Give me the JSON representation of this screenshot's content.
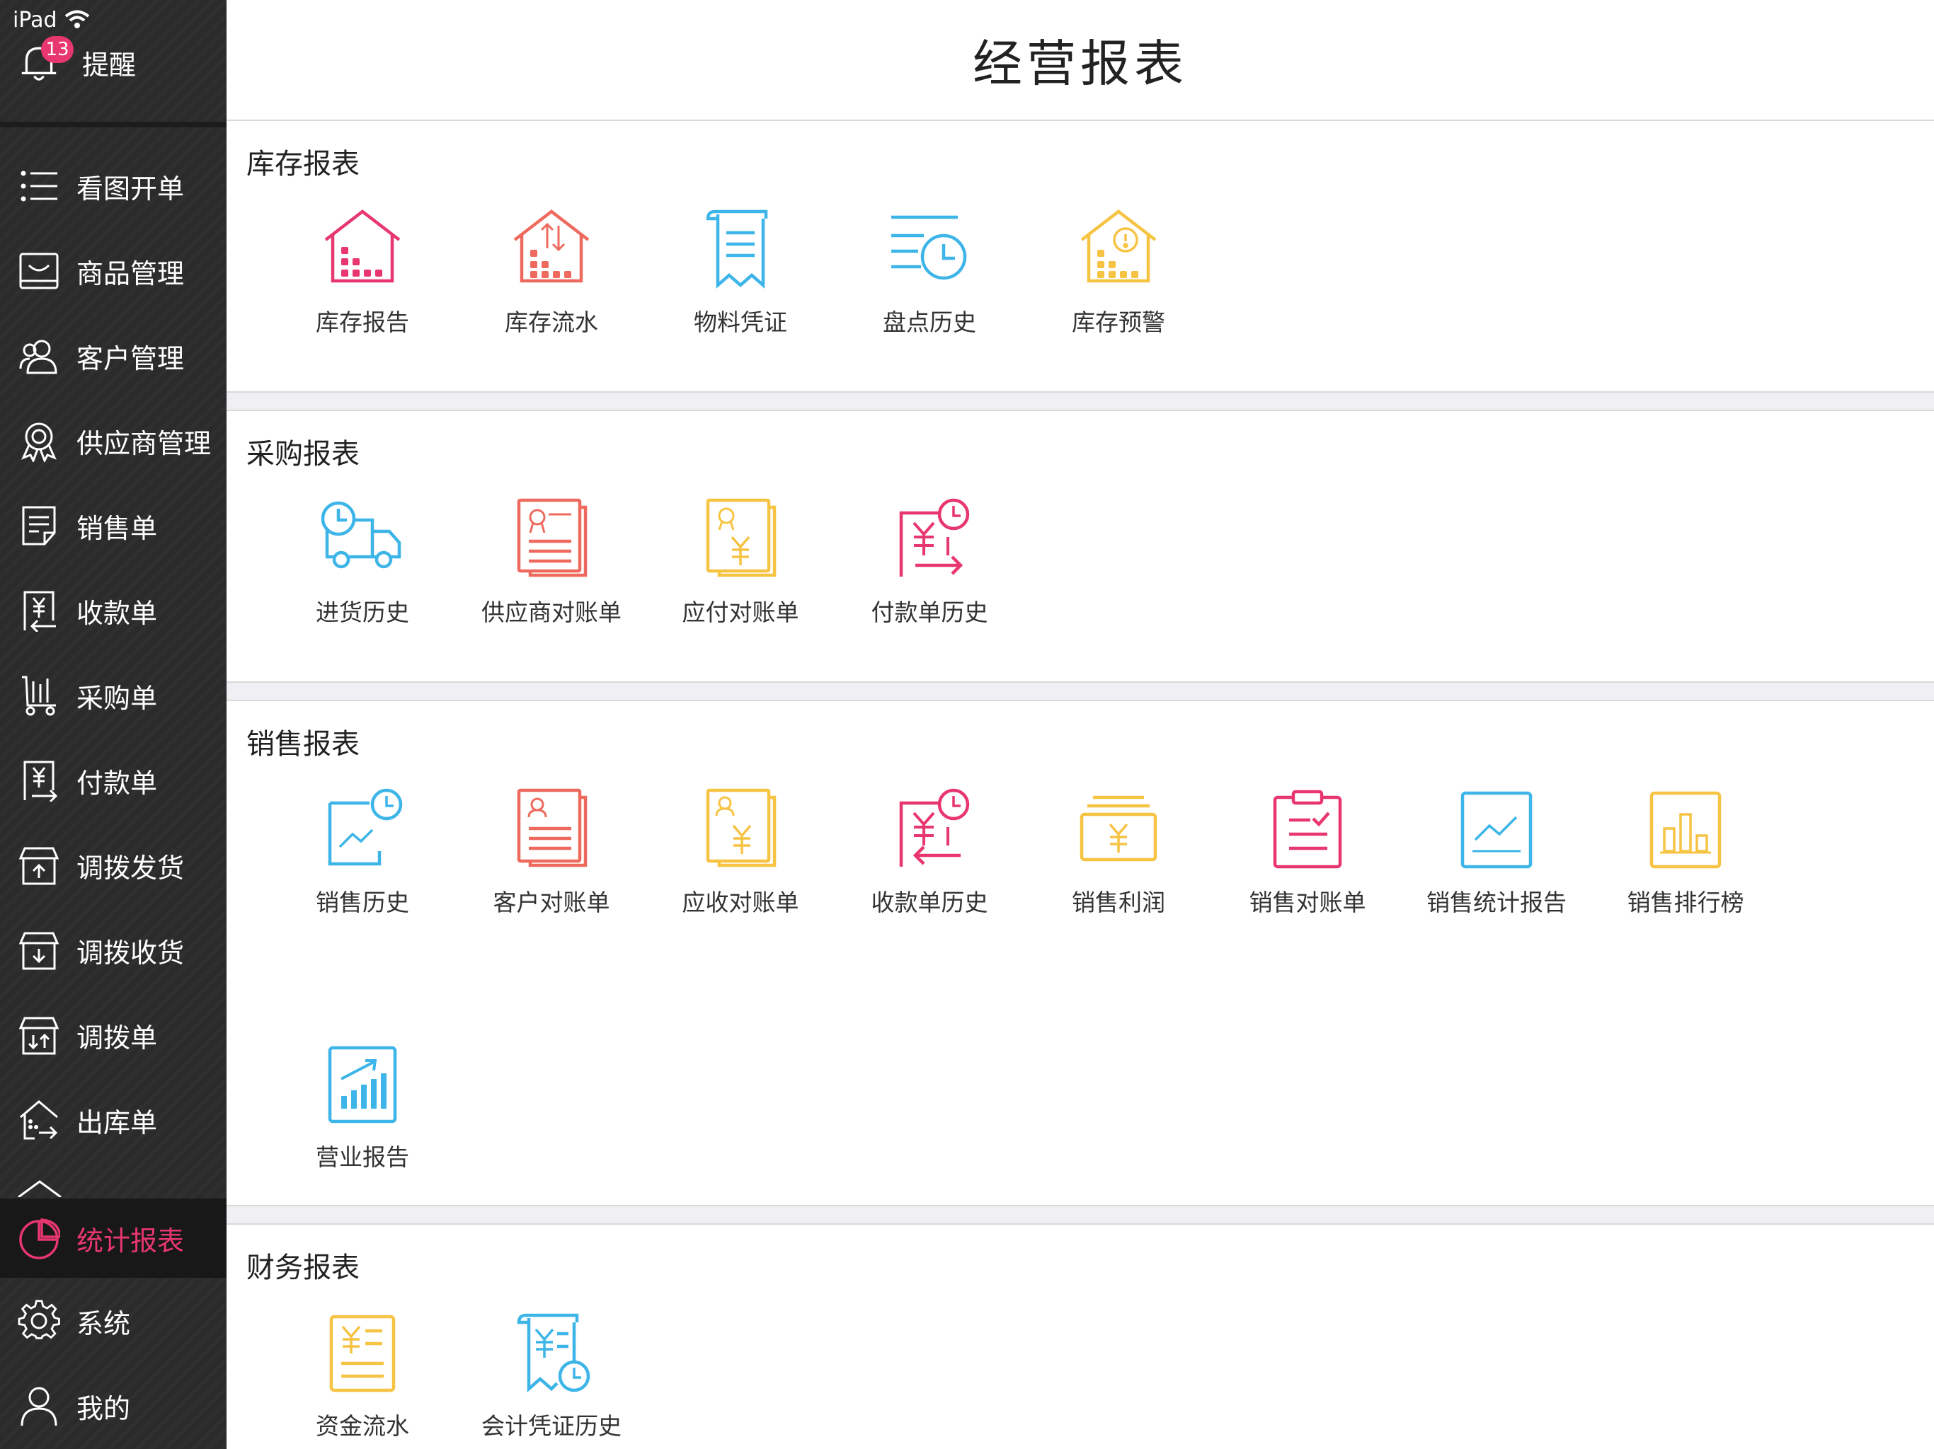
{
  "status_bar": {
    "device": "iPad"
  },
  "reminder": {
    "label": "提醒",
    "badge": "13"
  },
  "nav": [
    {
      "label": "看图开单",
      "icon": "list-icon"
    },
    {
      "label": "商品管理",
      "icon": "product-box-icon"
    },
    {
      "label": "客户管理",
      "icon": "customers-icon"
    },
    {
      "label": "供应商管理",
      "icon": "supplier-badge-icon"
    },
    {
      "label": "销售单",
      "icon": "sales-doc-icon"
    },
    {
      "label": "收款单",
      "icon": "receipt-yen-icon"
    },
    {
      "label": "采购单",
      "icon": "cart-icon"
    },
    {
      "label": "付款单",
      "icon": "payment-yen-icon"
    },
    {
      "label": "调拨发货",
      "icon": "transfer-send-icon"
    },
    {
      "label": "调拨收货",
      "icon": "transfer-receive-icon"
    },
    {
      "label": "调拨单",
      "icon": "transfer-doc-icon"
    },
    {
      "label": "出库单",
      "icon": "outbound-house-icon"
    },
    {
      "label": "统计报表",
      "icon": "pie-chart-icon"
    },
    {
      "label": "系统",
      "icon": "gear-icon"
    },
    {
      "label": "我的",
      "icon": "user-icon"
    }
  ],
  "page_title": "经营报表",
  "sections": [
    {
      "title": "库存报表",
      "items": [
        {
          "label": "库存报告",
          "icon": "house-dots-icon",
          "color": "#e8376f"
        },
        {
          "label": "库存流水",
          "icon": "house-flow-icon",
          "color": "#ee6a5e"
        },
        {
          "label": "物料凭证",
          "icon": "voucher-scroll-icon",
          "color": "#3db5e8"
        },
        {
          "label": "盘点历史",
          "icon": "inventory-clock-icon",
          "color": "#3db5e8"
        },
        {
          "label": "库存预警",
          "icon": "house-warning-icon",
          "color": "#f6c343"
        }
      ]
    },
    {
      "title": "采购报表",
      "items": [
        {
          "label": "进货历史",
          "icon": "truck-clock-icon",
          "color": "#3db5e8"
        },
        {
          "label": "供应商对账单",
          "icon": "supplier-statement-icon",
          "color": "#ee6a5e"
        },
        {
          "label": "应付对账单",
          "icon": "payable-statement-icon",
          "color": "#f6c343"
        },
        {
          "label": "付款单历史",
          "icon": "payment-history-icon",
          "color": "#e8376f"
        }
      ]
    },
    {
      "title": "销售报表",
      "items": [
        {
          "label": "销售历史",
          "icon": "sales-history-icon",
          "color": "#3db5e8"
        },
        {
          "label": "客户对账单",
          "icon": "customer-statement-icon",
          "color": "#ee6a5e"
        },
        {
          "label": "应收对账单",
          "icon": "receivable-statement-icon",
          "color": "#f6c343"
        },
        {
          "label": "收款单历史",
          "icon": "receipt-history-icon",
          "color": "#e8376f"
        },
        {
          "label": "销售利润",
          "icon": "profit-wallet-icon",
          "color": "#f6c343"
        },
        {
          "label": "销售对账单",
          "icon": "sales-statement-clipboard-icon",
          "color": "#e8376f"
        },
        {
          "label": "销售统计报告",
          "icon": "line-chart-icon",
          "color": "#3db5e8"
        },
        {
          "label": "销售排行榜",
          "icon": "bar-chart-icon",
          "color": "#f6c343"
        },
        {
          "label": "营业报告",
          "icon": "business-report-icon",
          "color": "#3db5e8"
        }
      ]
    },
    {
      "title": "财务报表",
      "items": [
        {
          "label": "资金流水",
          "icon": "cash-flow-icon",
          "color": "#f6c343"
        },
        {
          "label": "会计凭证历史",
          "icon": "accounting-voucher-icon",
          "color": "#3db5e8"
        }
      ]
    }
  ],
  "colors": {
    "accent": "#e8376f",
    "sidebar_bg": "#2b2b2b",
    "divider": "#efeff4"
  }
}
